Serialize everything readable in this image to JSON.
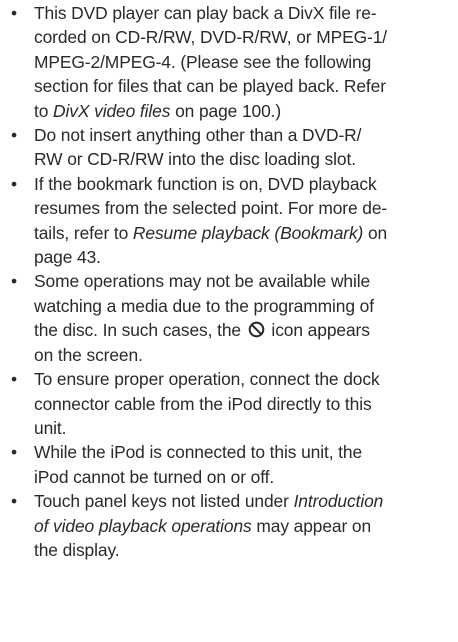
{
  "notes": [
    {
      "text_lines": [
        "This DVD player can play back a DivX file re-",
        "corded on CD-R/RW, DVD-R/RW, or MPEG-1/",
        "MPEG-2/MPEG-4. (Please see the following",
        "section for files that can be played back. Refer"
      ],
      "ref_italic": "DivX video files",
      "ref_tail": " on page 100.)"
    },
    {
      "text_lines": [
        "Do not insert anything other than a DVD-R/",
        "RW or CD-R/RW into the disc loading slot."
      ]
    },
    {
      "text_lines": [
        "If the bookmark function is on, DVD playback",
        "resumes from the selected point. For more de-"
      ],
      "line3_pre": "tails, refer to ",
      "ref_italic": "Resume playback (Bookmark)",
      "ref_tail": " on",
      "line4": "page 43."
    },
    {
      "text_lines": [
        "Some operations may not be available while",
        "watching a media due to the programming of"
      ],
      "line3_pre": "the disc. In such cases, the ",
      "icon": "prohibited-icon",
      "line3_post": " icon appears",
      "line4": "on the screen."
    },
    {
      "text_lines": [
        "To ensure proper operation, connect the dock",
        "connector cable from the iPod directly to this",
        "unit."
      ]
    },
    {
      "text_lines": [
        "While the iPod is connected to this unit, the",
        "iPod cannot be turned on or off."
      ]
    },
    {
      "line1_pre": "Touch panel keys not listed under ",
      "ref_italic_a": "Introduction",
      "ref_italic_b": "of video playback operations",
      "line2_post": " may appear on",
      "line3": "the display."
    }
  ],
  "bullet_char": "•"
}
